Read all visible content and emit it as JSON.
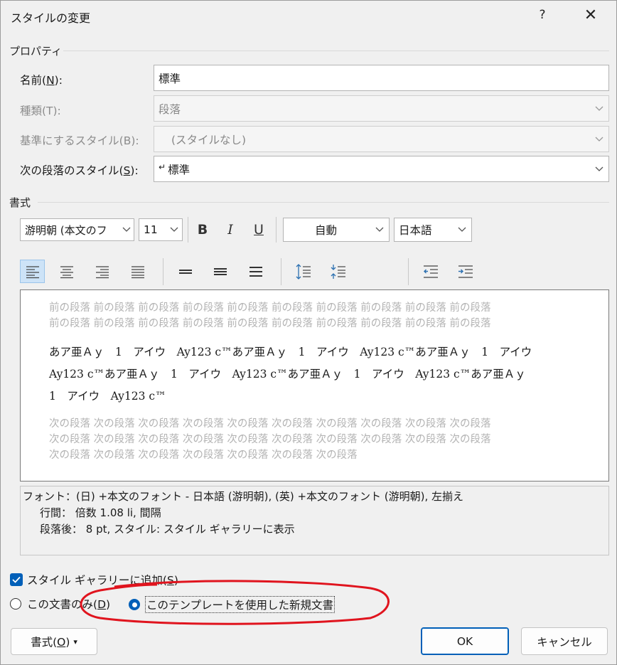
{
  "dialog": {
    "title": "スタイルの変更",
    "help_label": "?",
    "close_label": "✕"
  },
  "properties": {
    "group_label": "プロパティ",
    "name_label": "名前(N):",
    "name_value": "標準",
    "type_label": "種類(T):",
    "type_value": "段落",
    "based_on_label": "基準にするスタイル(B):",
    "based_on_value": "(スタイルなし)",
    "next_label": "次の段落のスタイル(S):",
    "next_value": "標準",
    "next_mark": "↵"
  },
  "format": {
    "group_label": "書式",
    "font_name": "游明朝 (本文のフ",
    "font_size": "11",
    "bold": "B",
    "italic": "I",
    "underline": "U",
    "color": "自動",
    "language": "日本語"
  },
  "preview": {
    "prev_lines": [
      "前の段落 前の段落 前の段落 前の段落 前の段落 前の段落 前の段落 前の段落 前の段落 前の段落",
      "前の段落 前の段落 前の段落 前の段落 前の段落 前の段落 前の段落 前の段落 前の段落 前の段落"
    ],
    "sample_lines": [
      "あア亜Ａｙ　1　アイウ　Ay123 c™あア亜Ａｙ　1　アイウ　Ay123 c™あア亜Ａｙ　1　アイウ",
      "Ay123 c™あア亜Ａｙ　1　アイウ　Ay123 c™あア亜Ａｙ　1　アイウ　Ay123 c™あア亜Ａｙ",
      "1　アイウ　Ay123 c™"
    ],
    "next_lines": [
      "次の段落 次の段落 次の段落 次の段落 次の段落 次の段落 次の段落 次の段落 次の段落 次の段落",
      "次の段落 次の段落 次の段落 次の段落 次の段落 次の段落 次の段落 次の段落 次の段落 次の段落",
      "次の段落 次の段落 次の段落 次の段落 次の段落 次の段落 次の段落"
    ]
  },
  "description": {
    "line1": "フォント：(日) +本文のフォント - 日本語 (游明朝), (英) +本文のフォント (游明朝), 左揃え",
    "line2": "行間：  倍数 1.08 li, 間隔",
    "line3": "段落後：  8 pt, スタイル: スタイル ギャラリーに表示"
  },
  "options": {
    "gallery_label": "スタイル ギャラリーに追加(S)",
    "gallery_checked": true,
    "this_doc_label": "この文書のみ(D)",
    "template_label": "このテンプレートを使用した新規文書",
    "selected": "template"
  },
  "buttons": {
    "format_label": "書式(O)",
    "format_arrow": "▾",
    "ok_label": "OK",
    "cancel_label": "キャンセル"
  },
  "colors": {
    "accent": "#005fb8",
    "annotation_ellipse": "#e0141e"
  }
}
